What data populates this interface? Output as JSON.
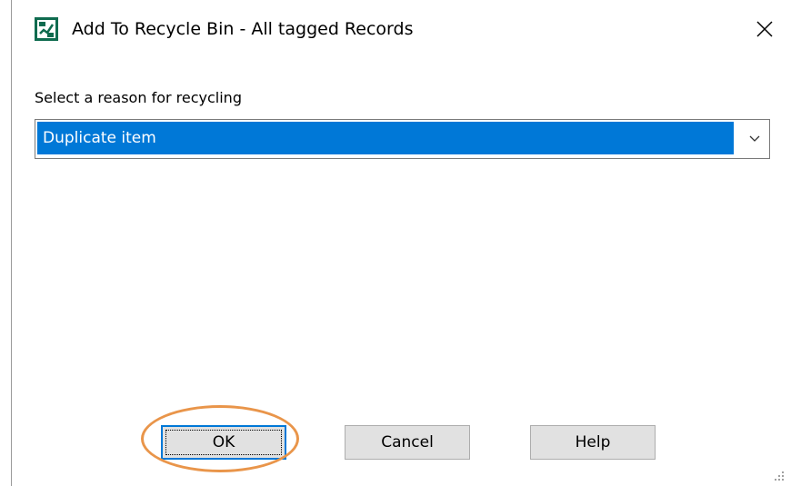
{
  "window": {
    "title": "Add To Recycle Bin - All tagged Records",
    "app_icon": "records-app-icon",
    "close_icon": "close-icon"
  },
  "form": {
    "reason_label": "Select a reason for recycling",
    "reason_selected": "Duplicate item",
    "dropdown_icon": "chevron-down-icon"
  },
  "buttons": {
    "ok_label": "OK",
    "cancel_label": "Cancel",
    "help_label": "Help"
  },
  "colors": {
    "selection": "#0078d7",
    "highlight_annotation": "#e9954a",
    "button_face": "#e1e1e1",
    "icon_green": "#0f6b4f"
  }
}
